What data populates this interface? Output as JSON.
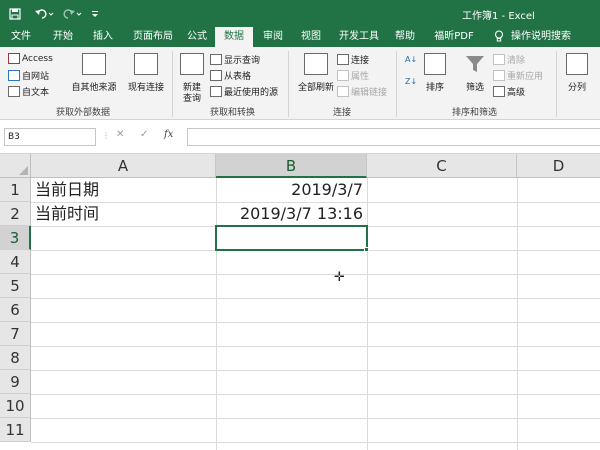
{
  "title_bar": {
    "title": "工作簿1 - Excel",
    "icons": [
      "save-icon",
      "undo-icon",
      "redo-icon",
      "customize-quick-access-icon"
    ]
  },
  "ribbon_tabs": [
    "文件",
    "开始",
    "插入",
    "页面布局",
    "公式",
    "数据",
    "审阅",
    "视图",
    "开发工具",
    "帮助",
    "福昕PDF",
    "操作说明搜索"
  ],
  "active_tab": "数据",
  "ribbon": {
    "get_external_data": {
      "label": "获取外部数据",
      "access": "Access",
      "from_web": "自网站",
      "from_text": "自文本",
      "from_other_sources": "自其他来源",
      "existing_connections": "现有连接"
    },
    "get_transform": {
      "label": "获取和转换",
      "new_query_line1": "新建",
      "new_query_line2": "查询",
      "show_queries": "显示查询",
      "from_table": "从表格",
      "recent_sources": "最近使用的源"
    },
    "connections": {
      "label": "连接",
      "refresh_all": "全部刷新",
      "connections": "连接",
      "properties": "属性",
      "edit_links": "编辑链接"
    },
    "sort_filter": {
      "label": "排序和筛选",
      "sort": "排序",
      "filter": "筛选",
      "clear": "清除",
      "reapply": "重新应用",
      "advanced": "高级"
    },
    "data_tools": {
      "text_to_columns": "分列"
    }
  },
  "formula_bar": {
    "name_box": "B3",
    "cancel": "✕",
    "enter": "✓",
    "fx": "fx",
    "content": ""
  },
  "grid": {
    "columns": [
      "A",
      "B",
      "C",
      "D"
    ],
    "selected_column": "B",
    "rows": [
      "1",
      "2",
      "3",
      "4",
      "5",
      "6",
      "7",
      "8",
      "9",
      "10",
      "11"
    ],
    "selected_row": "3",
    "cells": {
      "A1": "当前日期",
      "B1": "2019/3/7",
      "A2": "当前时间",
      "B2": "2019/3/7 13:16"
    },
    "active_cell": "B3"
  },
  "colors": {
    "excel_green": "#217346",
    "ribbon_bg": "#f3f3f3",
    "header_bg": "#e6e6e6"
  }
}
